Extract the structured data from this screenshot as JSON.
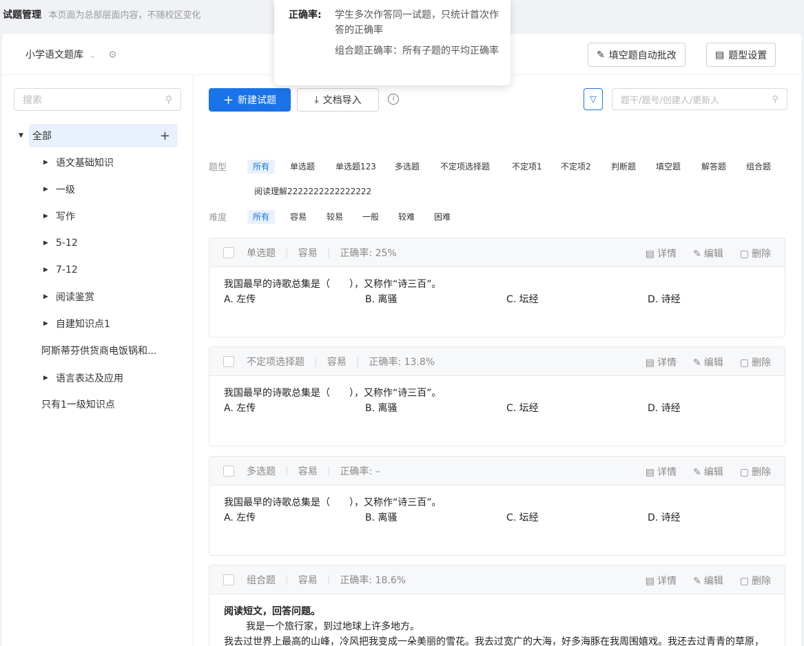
{
  "topbar": {
    "title": "试题管理",
    "subtitle": "本页面为总部层面内容，不随校区变化"
  },
  "tooltip": {
    "label": "正确率:",
    "line1": "学生多次作答同一试题，只统计首次作答的正确率",
    "line2": "组合题正确率：所有子题的平均正确率"
  },
  "header": {
    "bank_name": "小学语文题库",
    "auto_grade_label": "填空题自动批改",
    "type_settings_label": "题型设置"
  },
  "sidebar": {
    "search_placeholder": "搜索",
    "root_label": "全部",
    "items": [
      {
        "label": "语文基础知识",
        "expandable": true
      },
      {
        "label": "一级",
        "expandable": true
      },
      {
        "label": "写作",
        "expandable": true
      },
      {
        "label": "5-12",
        "expandable": true
      },
      {
        "label": "7-12",
        "expandable": true
      },
      {
        "label": "阅读鉴赏",
        "expandable": true
      },
      {
        "label": "自建知识点1",
        "expandable": true
      },
      {
        "label": "阿斯蒂芬供货商电饭锅和...",
        "expandable": false
      },
      {
        "label": "语言表达及应用",
        "expandable": true
      },
      {
        "label": "只有1一级知识点",
        "expandable": false
      }
    ]
  },
  "toolbar": {
    "new_label": "新建试题",
    "import_label": "文档导入",
    "search_placeholder": "题干/题号/创建人/更新人"
  },
  "filters": {
    "type_label": "题型",
    "types": [
      "所有",
      "单选题",
      "单选题123",
      "多选题",
      "不定项选择题",
      "不定项1",
      "不定项2",
      "判断题",
      "填空题",
      "解答题",
      "组合题",
      "阅读理解2222222222222222"
    ],
    "difficulty_label": "难度",
    "difficulties": [
      "所有",
      "容易",
      "较易",
      "一般",
      "较难",
      "困难"
    ]
  },
  "card_actions": {
    "detail": "详情",
    "edit": "编辑",
    "delete": "删除"
  },
  "questions": [
    {
      "type": "单选题",
      "difficulty": "容易",
      "accuracy": "正确率: 25%",
      "stem": "我国最早的诗歌总集是（　　），又称作“诗三百”。",
      "options": [
        "A. 左传",
        "B. 离骚",
        "C. 坛经",
        "D. 诗经"
      ]
    },
    {
      "type": "不定项选择题",
      "difficulty": "容易",
      "accuracy": "正确率: 13.8%",
      "stem": "我国最早的诗歌总集是（　　），又称作“诗三百”。",
      "options": [
        "A. 左传",
        "B. 离骚",
        "C. 坛经",
        "D. 诗经"
      ]
    },
    {
      "type": "多选题",
      "difficulty": "容易",
      "accuracy": "正确率: –",
      "stem": "我国最早的诗歌总集是（　　），又称作“诗三百”。",
      "options": [
        "A. 左传",
        "B. 离骚",
        "C. 坛经",
        "D. 诗经"
      ]
    },
    {
      "type": "组合题",
      "difficulty": "容易",
      "accuracy": "正确率: 18.6%",
      "heading": "阅读短文，回答问题。",
      "para1": "我是一个旅行家，到过地球上许多地方。",
      "para2": "我去过世界上最高的山峰，冷风把我变成一朵美丽的雪花。我去过宽广的大海，好多海豚在我周围嬉戏。我还去过青青的草原，落在骏马的背上，跟它一起奔跑。"
    }
  ],
  "colors": {
    "primary": "#1a73e8",
    "selected_bg": "#e8f1fd"
  }
}
